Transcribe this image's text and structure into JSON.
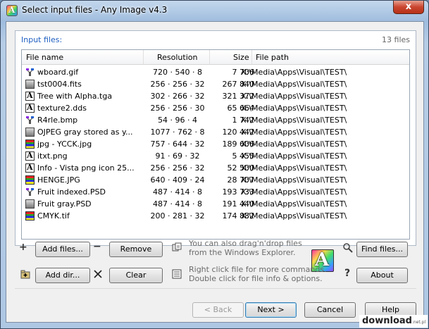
{
  "window": {
    "title": "Select input files - Any Image v4.3",
    "close_label": "x",
    "app_icon_letter": "A"
  },
  "panel": {
    "label": "Input files:",
    "count": "13 files"
  },
  "columns": {
    "name": "File name",
    "resolution": "Resolution",
    "size": "Size",
    "path": "File path"
  },
  "files": [
    {
      "name": "wboard.gif",
      "resolution": "720 · 540 · 8",
      "size": "7 706",
      "path": "X:\\Media\\Apps\\Visual\\TEST\\",
      "icon": "tree-icon"
    },
    {
      "name": "tst0004.fits",
      "resolution": "256 · 256 · 32",
      "size": "267 840",
      "path": "X:\\Media\\Apps\\Visual\\TEST\\",
      "icon": "gray-image-icon"
    },
    {
      "name": "Tree with Alpha.tga",
      "resolution": "302 · 266 · 32",
      "size": "321 372",
      "path": "X:\\Media\\Apps\\Visual\\TEST\\",
      "icon": "alpha-image-icon"
    },
    {
      "name": "texture2.dds",
      "resolution": "256 · 256 · 30",
      "size": "65 664",
      "path": "X:\\Media\\Apps\\Visual\\TEST\\",
      "icon": "alpha-image-icon"
    },
    {
      "name": "R4rle.bmp",
      "resolution": "54 · 96 · 4",
      "size": "1 742",
      "path": "X:\\Media\\Apps\\Visual\\TEST\\",
      "icon": "tree-icon"
    },
    {
      "name": "OJPEG gray stored as y...",
      "resolution": "1077 · 762 · 8",
      "size": "120 442",
      "path": "X:\\Media\\Apps\\Visual\\TEST\\",
      "icon": "gray-image-icon"
    },
    {
      "name": "jpg - YCCK.jpg",
      "resolution": "757 · 644 · 32",
      "size": "189 606",
      "path": "X:\\Media\\Apps\\Visual\\TEST\\",
      "icon": "color-image-icon"
    },
    {
      "name": "itxt.png",
      "resolution": "91 · 69 · 32",
      "size": "5 455",
      "path": "X:\\Media\\Apps\\Visual\\TEST\\",
      "icon": "alpha-image-icon"
    },
    {
      "name": "Info - Vista png icon 25...",
      "resolution": "256 · 256 · 32",
      "size": "52 500",
      "path": "X:\\Media\\Apps\\Visual\\TEST\\",
      "icon": "alpha-image-icon"
    },
    {
      "name": "HENGE.JPG",
      "resolution": "640 · 409 · 24",
      "size": "28 707",
      "path": "X:\\Media\\Apps\\Visual\\TEST\\",
      "icon": "color-image-icon"
    },
    {
      "name": "Fruit indexed.PSD",
      "resolution": "487 · 414 · 8",
      "size": "193 733",
      "path": "X:\\Media\\Apps\\Visual\\TEST\\",
      "icon": "tree-icon"
    },
    {
      "name": "Fruit gray.PSD",
      "resolution": "487 · 414 · 8",
      "size": "191 440",
      "path": "X:\\Media\\Apps\\Visual\\TEST\\",
      "icon": "gray-image-icon"
    },
    {
      "name": "CMYK.tif",
      "resolution": "200 · 281 · 32",
      "size": "174 882",
      "path": "X:\\Media\\Apps\\Visual\\TEST\\",
      "icon": "color-image-icon"
    }
  ],
  "actions": {
    "add_files": "Add files...",
    "remove": "Remove",
    "add_dir": "Add dir...",
    "clear": "Clear",
    "find_files": "Find files...",
    "about": "About",
    "plus_symbol": "+",
    "minus_symbol": "−",
    "question_symbol": "?"
  },
  "hints": {
    "drag_line1": "You can also drag'n'drop files",
    "drag_line2": "from the Windows Explorer.",
    "right_line1": "Right click file for more commands.",
    "right_line2": "Double click for file info & options."
  },
  "logo_letter": "A",
  "wizard": {
    "back": "< Back",
    "next": "Next >",
    "cancel": "Cancel",
    "help": "Help"
  },
  "watermark": {
    "text": "download",
    "suffix": ".net.pl"
  }
}
